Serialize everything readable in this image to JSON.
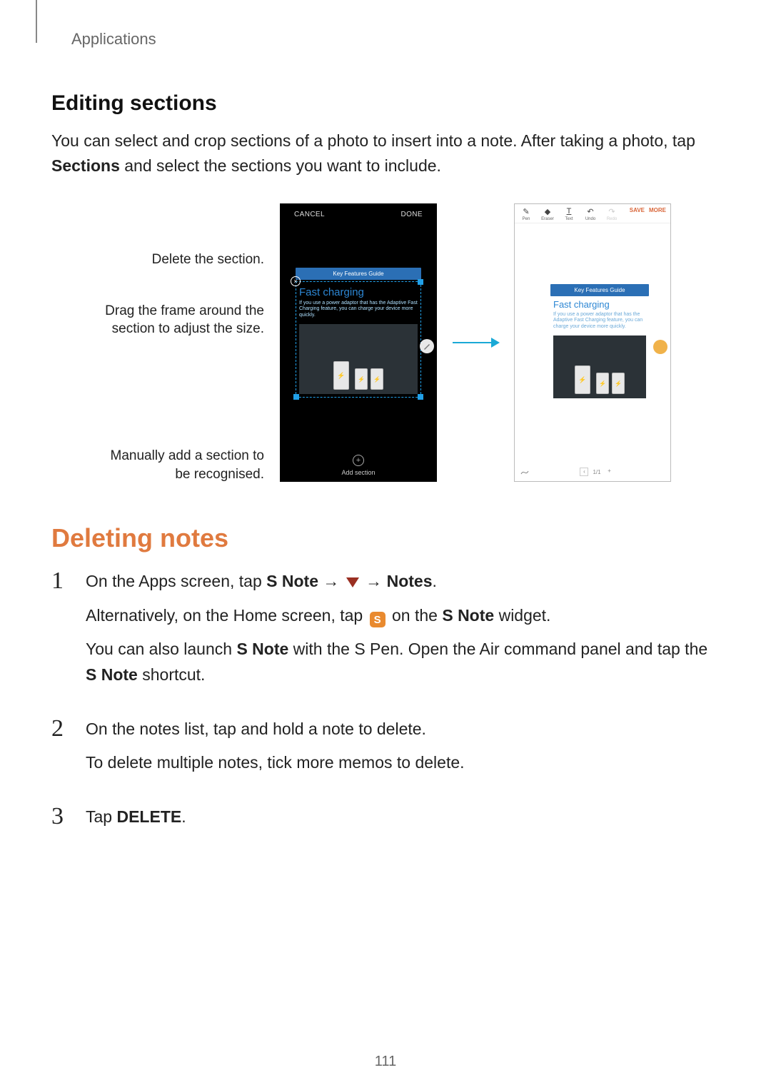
{
  "breadcrumb": "Applications",
  "section_heading": "Editing sections",
  "section_para_pre": "You can select and crop sections of a photo to insert into a note. After taking a photo, tap ",
  "section_para_bold": "Sections",
  "section_para_post": " and select the sections you want to include.",
  "callouts": {
    "delete": "Delete the section.",
    "drag": "Drag the frame around the section to adjust the size.",
    "add": "Manually add a section to be recognised."
  },
  "phone1": {
    "cancel": "CANCEL",
    "done": "DONE",
    "kfg": "Key Features Guide",
    "fc_title": "Fast charging",
    "fc_sub": "If you use a power adaptor that has the Adaptive Fast Charging feature, you can charge your device more quickly.",
    "add_section": "Add section"
  },
  "phone2": {
    "toolbar": {
      "pen": "Pen",
      "eraser": "Eraser",
      "text": "Text",
      "undo": "Undo",
      "redo": "Redo",
      "save": "SAVE",
      "more": "MORE"
    },
    "kfg": "Key Features Guide",
    "fc_title": "Fast charging",
    "fc_sub": "If you use a power adaptor that has the Adaptive Fast Charging feature, you can charge your device more quickly.",
    "page_indicator": "1/1"
  },
  "deleting_heading": "Deleting notes",
  "steps": {
    "s1_num": "1",
    "s1_a_pre": "On the Apps screen, tap ",
    "s1_a_b1": "S Note",
    "s1_a_arrow1": " → ",
    "s1_a_arrow2": " → ",
    "s1_a_b2": "Notes",
    "s1_a_post": ".",
    "s1_b_pre": "Alternatively, on the Home screen, tap ",
    "s1_b_mid": " on the ",
    "s1_b_b1": "S Note",
    "s1_b_post": " widget.",
    "s1_c_pre": "You can also launch ",
    "s1_c_b1": "S Note",
    "s1_c_mid": " with the S Pen. Open the Air command panel and tap the ",
    "s1_c_b2": "S Note",
    "s1_c_post": " shortcut.",
    "s2_num": "2",
    "s2_a": "On the notes list, tap and hold a note to delete.",
    "s2_b": "To delete multiple notes, tick more memos to delete.",
    "s3_num": "3",
    "s3_pre": "Tap ",
    "s3_b": "DELETE",
    "s3_post": "."
  },
  "page_number": "111"
}
